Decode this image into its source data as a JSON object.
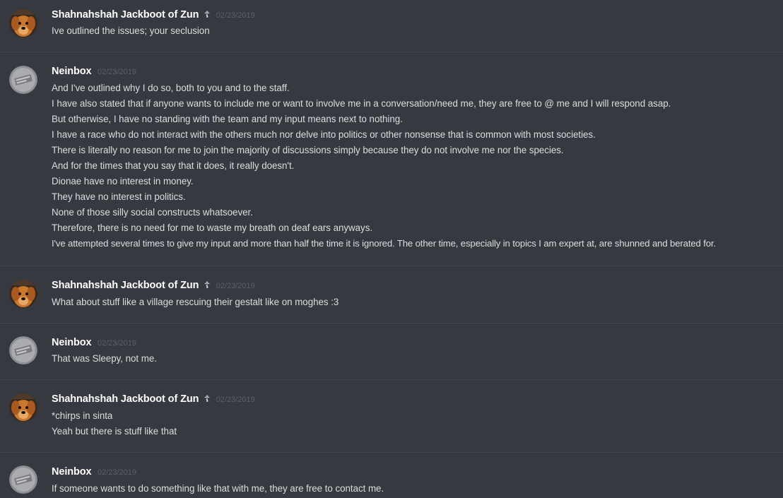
{
  "messages": [
    {
      "author": "Shahnahshah Jackboot of Zun",
      "badge": "☦",
      "avatar": "dog-avatar",
      "timestamp": "02/23/2019",
      "lines": [
        "Ive outlined the issues; your seclusion"
      ]
    },
    {
      "author": "Neinbox",
      "badge": "",
      "avatar": "gray-logo-avatar",
      "timestamp": "02/23/2019",
      "lines": [
        "And I've outlined why I do so, both to you and to the staff.",
        "I have also stated that if anyone wants to include me or want to involve me in a conversation/need me, they are free to @ me and I will respond asap.",
        "But otherwise, I have no standing with the team and my input means next to nothing.",
        "I have a race who do not interact with the others much nor delve into politics or other nonsense that is common with most societies.",
        "There is literally no reason for me to join the majority of discussions simply because they do not involve me nor the species.",
        "And for the times that you say that it does, it really doesn't.",
        "Dionae have no interest in money.",
        "They have no interest in politics.",
        "None of those silly social constructs whatsoever.",
        "Therefore, there is no need for me to waste my breath on deaf ears anyways.",
        "I've attempted several times to give my input and more than half the time it is ignored. The other time, especially in topics I am expert at, are shunned and berated for."
      ]
    },
    {
      "author": "Shahnahshah Jackboot of Zun",
      "badge": "☦",
      "avatar": "dog-avatar",
      "timestamp": "02/23/2019",
      "lines": [
        "What about stuff like a village rescuing their gestalt like on moghes :3"
      ]
    },
    {
      "author": "Neinbox",
      "badge": "",
      "avatar": "gray-logo-avatar",
      "timestamp": "02/23/2019",
      "lines": [
        "That was Sleepy, not me."
      ]
    },
    {
      "author": "Shahnahshah Jackboot of Zun",
      "badge": "☦",
      "avatar": "dog-avatar",
      "timestamp": "02/23/2019",
      "lines": [
        "*chirps in sinta",
        "Yeah but there is stuff like that"
      ]
    },
    {
      "author": "Neinbox",
      "badge": "",
      "avatar": "gray-logo-avatar",
      "timestamp": "02/23/2019",
      "lines": [
        "If someone wants to do something like that with me, they are free to contact me."
      ]
    }
  ]
}
